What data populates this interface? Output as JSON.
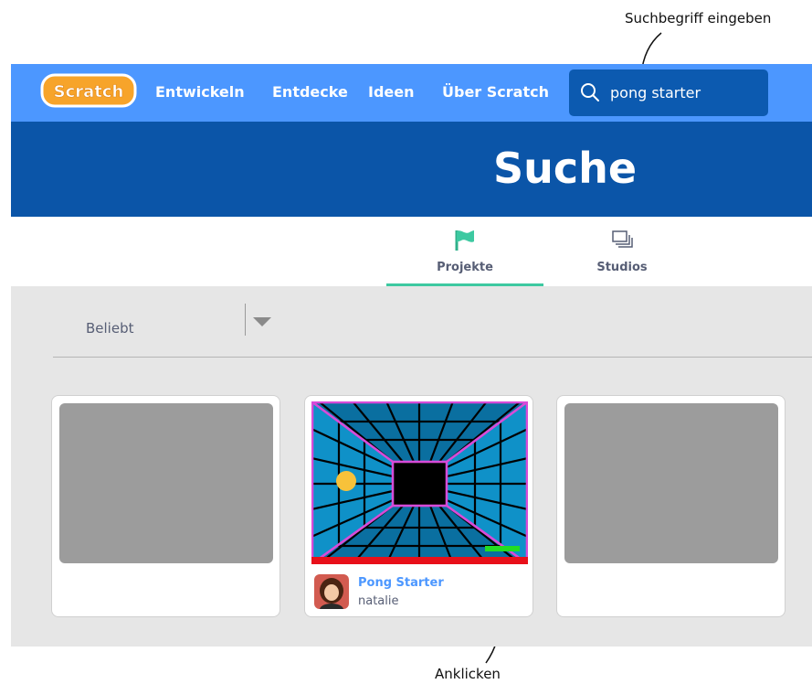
{
  "annotations": {
    "search_hint": "Suchbegriff eingeben",
    "click_hint": "Anklicken"
  },
  "navbar": {
    "logo": "Scratch",
    "items": [
      "Entwickeln",
      "Entdecke",
      "Ideen",
      "Über Scratch"
    ],
    "search_value": "pong starter"
  },
  "banner": {
    "title": "Suche"
  },
  "tabs": [
    {
      "label": "Projekte",
      "icon": "flag-icon",
      "active": true
    },
    {
      "label": "Studios",
      "icon": "studios-icon",
      "active": false
    }
  ],
  "sort": {
    "selected": "Beliebt"
  },
  "results": [
    {
      "title": "",
      "author": "",
      "placeholder": true
    },
    {
      "title": "Pong Starter",
      "author": "natalie",
      "placeholder": false
    },
    {
      "title": "",
      "author": "",
      "placeholder": true
    }
  ],
  "colors": {
    "nav_blue": "#4c97ff",
    "banner_blue": "#0b55a8",
    "search_bg": "#0c5ab0",
    "tab_accent": "#3dc9a1",
    "link_blue": "#4c97ff"
  }
}
